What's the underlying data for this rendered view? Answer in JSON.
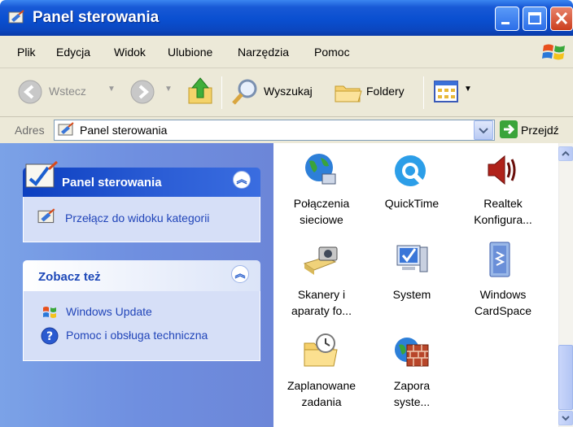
{
  "window": {
    "title": "Panel sterowania"
  },
  "menu": [
    "Plik",
    "Edycja",
    "Widok",
    "Ulubione",
    "Narzędzia",
    "Pomoc"
  ],
  "toolbar": {
    "back_label": "Wstecz",
    "search_label": "Wyszukaj",
    "folders_label": "Foldery"
  },
  "address": {
    "label": "Adres",
    "value": "Panel sterowania",
    "go_label": "Przejdź"
  },
  "tasks": {
    "control_panel": {
      "title": "Panel sterowania",
      "switch_view": "Przełącz do widoku kategorii"
    },
    "see_also": {
      "title": "Zobacz też",
      "links": [
        "Windows Update",
        "Pomoc i obsługa techniczna"
      ]
    }
  },
  "items": [
    {
      "icon": "network-globe-icon",
      "line1": "Połączenia",
      "line2": "sieciowe"
    },
    {
      "icon": "quicktime-icon",
      "line1": "QuickTime",
      "line2": ""
    },
    {
      "icon": "speaker-icon",
      "line1": "Realtek",
      "line2": "Konfigura..."
    },
    {
      "icon": "scanner-camera-icon",
      "line1": "Skanery i",
      "line2": "aparaty fo..."
    },
    {
      "icon": "monitor-check-icon",
      "line1": "System",
      "line2": ""
    },
    {
      "icon": "cardspace-icon",
      "line1": "Windows",
      "line2": "CardSpace"
    },
    {
      "icon": "scheduled-folder-icon",
      "line1": "Zaplanowane",
      "line2": "zadania"
    },
    {
      "icon": "firewall-globe-icon",
      "line1": "Zapora",
      "line2": "syste..."
    }
  ]
}
